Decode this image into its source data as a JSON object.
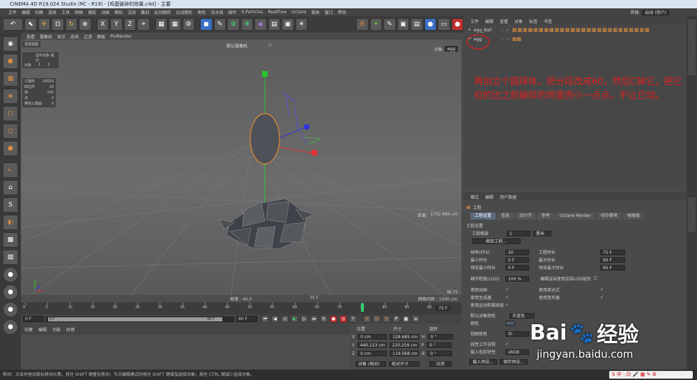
{
  "window": {
    "title": "CINEMA 4D R19.024 Studio (RC - R19) - [鸡蛋破碎的效果.c4d] - 主要"
  },
  "menu": {
    "items": [
      "文件",
      "编辑",
      "创建",
      "选择",
      "工具",
      "网格",
      "捕捉",
      "动画",
      "模拟",
      "渲染",
      "雕刻",
      "运动跟踪",
      "运动图形",
      "角色",
      "流水线",
      "插件",
      "X-Particles",
      "RealFlow",
      "Octane",
      "脚本",
      "窗口",
      "帮助"
    ],
    "layout_label": "界面:",
    "layout_value": "启动 (用户)"
  },
  "toolbar": {
    "xyz": [
      "X",
      "Y",
      "Z"
    ]
  },
  "viewport": {
    "menu": [
      "查看",
      "摄像机",
      "显示",
      "选项",
      "过滤",
      "面板",
      "ProRender"
    ],
    "camera_label": "默认摄像机",
    "hud_title": "选中对象 组计",
    "hud_obj_label": "对象",
    "hud_obj_val1": "1",
    "hud_obj_val2": "2",
    "stats": [
      [
        "三角形",
        "20020"
      ],
      [
        "四边形",
        "19"
      ],
      [
        "线",
        "105"
      ],
      [
        "点",
        "0"
      ],
      [
        "带状三角面",
        "0"
      ]
    ],
    "dist_label": "距离:",
    "dist_value": "1752.884 cm",
    "frame_label": "帧:75",
    "frame_rate": "帧速 : 40.0",
    "frame_time": "75 F",
    "grid_label": "网格间距 : 1000 cm",
    "obj_label": "对象",
    "obj_value": "egg"
  },
  "timeline": {
    "ticks": [
      "0",
      "5",
      "10",
      "15",
      "20",
      "25",
      "30",
      "35",
      "40",
      "45",
      "50",
      "55",
      "60",
      "65",
      "70",
      "75",
      "80",
      "85",
      "90"
    ],
    "current": "75 F",
    "end": "75 F"
  },
  "transport": {
    "start": "0 F",
    "range_start": "0 F",
    "range_end": "90 F",
    "end": "90 F"
  },
  "materials": {
    "menu": [
      "创建",
      "编辑",
      "功能",
      "纹理"
    ]
  },
  "coords": {
    "headers": [
      "位置",
      "尺寸",
      "旋转"
    ],
    "rows": [
      [
        "X",
        "0 cm",
        "128.685 cm",
        "H",
        "0 °"
      ],
      [
        "Y",
        "440.123 cm",
        "220.259 cm",
        "P",
        "0 °"
      ],
      [
        "Z",
        "0 cm",
        "119.568 cm",
        "B",
        "0 °"
      ]
    ],
    "mode": "对象 (相对)",
    "size_mode": "绝对尺寸",
    "apply": "应用"
  },
  "objects": {
    "menu": [
      "文件",
      "编辑",
      "查看",
      "对象",
      "标签",
      "书签"
    ],
    "items": [
      {
        "name": "egg_Ball"
      },
      {
        "name": "egg"
      }
    ]
  },
  "attributes": {
    "menu": [
      "模式",
      "编辑",
      "用户数据"
    ],
    "section": "工程",
    "tabs": [
      "工程设置",
      "信息",
      "动力学",
      "参考",
      "Octane Render",
      "待办事项",
      "帧插值"
    ],
    "group": "工程设置",
    "scale_label": "工程缩放",
    "scale_value": "1",
    "scale_unit": "厘米",
    "scale_button": "缩放工程...",
    "left_fields": [
      [
        "帧率(FPS)",
        "30"
      ],
      [
        "最小时长",
        "0 F"
      ],
      [
        "预览最小时长",
        "0 F"
      ]
    ],
    "right_fields": [
      [
        "工程时长",
        "75 F"
      ],
      [
        "最大时长",
        "90 F"
      ],
      [
        "预览最大时长",
        "90 F"
      ]
    ],
    "lod_label": "细节程度(LOD)",
    "lod_value": "100 %",
    "lod_check": "编辑渲染使用渲染LOD级别",
    "checks_left": [
      "使用动画",
      "使用生成器",
      "使用运动剪辑系统"
    ],
    "checks_right": [
      "使用表达式",
      "使用变形器"
    ],
    "color_label": "默认对象颜色",
    "color_value": "灰蓝色",
    "color2_label": "颜色",
    "view_label": "视图修剪",
    "view_value": "中",
    "lin_label": "线性工作流程",
    "input_label": "输入色彩特性",
    "input_value": "sRGB",
    "btn_load": "载入预设...",
    "btn_save": "保存预设..."
  },
  "status": {
    "text": "移动：点击并拖动鼠标移动元素。按住 SHIFT 键量化移动；节点编辑模式时按住 SHIFT 键增加选择对象；按住 CTRL 键减少选择对象。"
  },
  "annotation": {
    "text": "再创立个圆球体，把分段改成60，然后C掉它，把它拉的比之前破碎的鸡蛋壳小一点点，不让它动。"
  },
  "watermark": {
    "brand": "Bai",
    "brand2": "经验",
    "url": "jingyan.baidu.com"
  },
  "colors": {
    "accent": "#5b6b80",
    "annotation": "#e02020",
    "green_axis": "#28c828",
    "red_axis": "#e03030",
    "blue_axis": "#3030e0",
    "egg_outline": "#e08a30"
  }
}
